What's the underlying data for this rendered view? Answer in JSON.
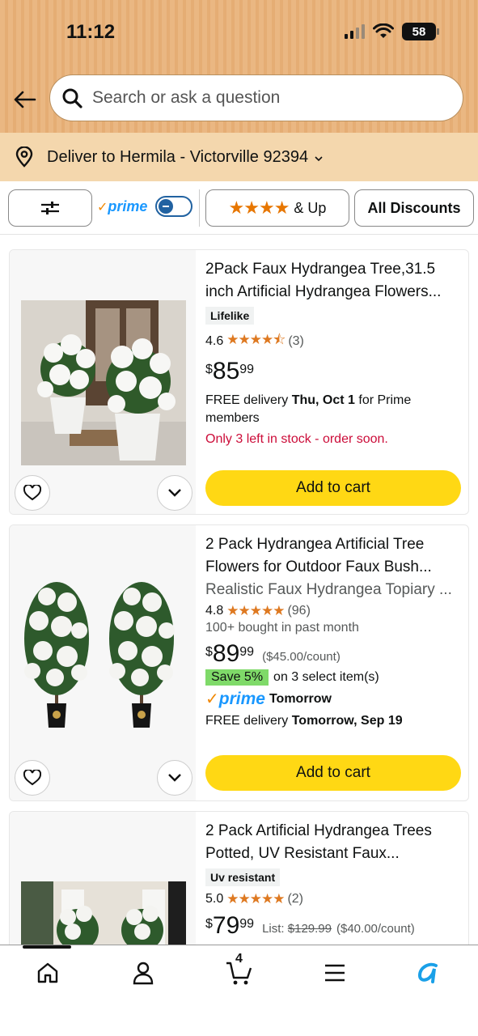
{
  "status_bar": {
    "time": "11:12",
    "battery": "58"
  },
  "search": {
    "placeholder": "Search or ask a question"
  },
  "delivery_bar": {
    "text": "Deliver to Hermila - Victorville 92394"
  },
  "filters": {
    "prime_label": "prime",
    "rating_label": "& Up",
    "discounts_label": "All Discounts"
  },
  "products": [
    {
      "title": "2Pack Faux Hydrangea Tree,31.5 inch Artificial Hydrangea Flowers...",
      "badge": "Lifelike",
      "rating": "4.6",
      "stars": "★★★★⯪",
      "review_count": "(3)",
      "price_symbol": "$",
      "price_whole": "85",
      "price_fraction": "99",
      "delivery_prefix": "FREE delivery ",
      "delivery_date": "Thu, Oct 1",
      "delivery_suffix": " for Prime members",
      "stock": "Only 3 left in stock - order soon.",
      "button": "Add to cart"
    },
    {
      "title": "2 Pack Hydrangea Artificial Tree Flowers for Outdoor Faux Bush...",
      "subtitle": "Realistic Faux Hydrangea Topiary ...",
      "rating": "4.8",
      "stars": "★★★★★",
      "review_count": "(96)",
      "bought": "100+ bought in past month",
      "price_symbol": "$",
      "price_whole": "89",
      "price_fraction": "99",
      "unit_price": "($45.00/count)",
      "save_badge": "Save 5%",
      "save_text": "on 3 select item(s)",
      "prime_text": "prime",
      "prime_day": "Tomorrow",
      "delivery_prefix": "FREE delivery ",
      "delivery_date": "Tomorrow, Sep 19",
      "button": "Add to cart"
    },
    {
      "title": "2 Pack Artificial Hydrangea Trees Potted, UV Resistant Faux...",
      "badge": "Uv resistant",
      "rating": "5.0",
      "stars": "★★★★★",
      "review_count": "(2)",
      "price_symbol": "$",
      "price_whole": "79",
      "price_fraction": "99",
      "list_label": "List: ",
      "list_price": "$129.99",
      "unit_price": "($40.00/count)"
    }
  ],
  "tabbar": {
    "cart_count": "4"
  },
  "colors": {
    "header": "#eab782",
    "delivery_bg": "#f4d7ad",
    "cart_button": "#ffd814",
    "star": "#de7921",
    "stock_red": "#cc0c39",
    "save_green": "#7fda69",
    "prime_blue": "#1a98ff"
  }
}
